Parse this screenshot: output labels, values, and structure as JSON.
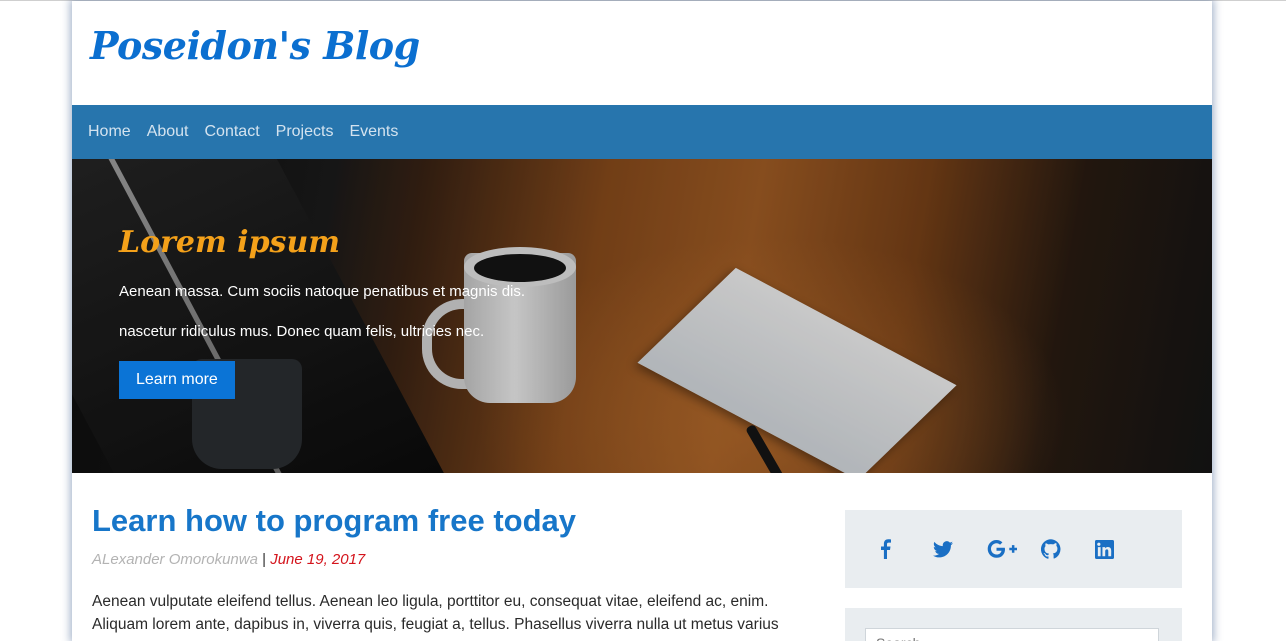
{
  "site": {
    "brand": "Poseidon's Blog"
  },
  "nav": {
    "items": [
      "Home",
      "About",
      "Contact",
      "Projects",
      "Events"
    ]
  },
  "hero": {
    "title": "Lorem ipsum",
    "line1": "Aenean massa. Cum sociis natoque penatibus et magnis dis.",
    "line2": "nascetur ridiculus mus. Donec quam felis, ultricies nec.",
    "button": "Learn more"
  },
  "post": {
    "title": "Learn how to program free today",
    "author": "ALexander Omorokunwa",
    "separator": "|",
    "date": "June 19, 2017",
    "excerpt": "Aenean vulputate eleifend tellus. Aenean leo ligula, porttitor eu, consequat vitae, eleifend ac, enim. Aliquam lorem ante, dapibus in, viverra quis, feugiat a, tellus. Phasellus viverra nulla ut metus varius"
  },
  "sidebar": {
    "social": [
      "facebook-icon",
      "twitter-icon",
      "google-plus-icon",
      "github-icon",
      "linkedin-icon"
    ],
    "search_placeholder": "Search..."
  },
  "colors": {
    "brand": "#0b6fd0",
    "nav_bg": "#2775ad",
    "hero_title": "#f4a11a",
    "button": "#0b74d6",
    "date": "#d4141c"
  }
}
